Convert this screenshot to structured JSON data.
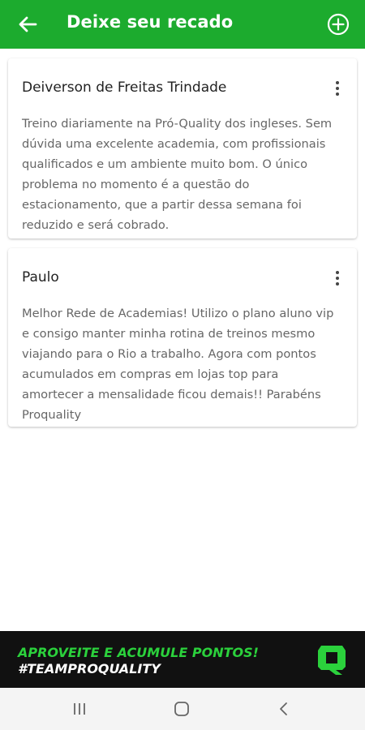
{
  "header": {
    "title": "Deixe seu recado",
    "back_icon": "arrow-left-icon",
    "add_icon": "plus-circle-icon",
    "color": "#1cab2e"
  },
  "messages": [
    {
      "name": "Deiverson de Freitas Trindade",
      "lines": [
        "Treino diariamente na Pró-Quality dos ingleses. Sem",
        "dúvida uma excelente academia, com profissionais",
        "qualificados e um ambiente muito bom. O único",
        "problema no momento é a questão do",
        "estacionamento, que a partir dessa semana foi",
        "reduzido e será cobrado."
      ]
    },
    {
      "name": "Paulo",
      "lines": [
        "Melhor Rede de Academias! Utilizo o plano aluno vip",
        "e consigo manter minha rotina de treinos mesmo",
        "viajando para o Rio a trabalho. Agora com pontos",
        "acumulados em compras em lojas top para",
        "amortecer a mensalidade ficou demais!! Parabéns",
        "Proquality"
      ]
    }
  ],
  "banner": {
    "line1": "APROVEITE E ACUMULE PONTOS!",
    "line2": "#TEAMPROQUALITY",
    "accent": "#2bd13c"
  },
  "navbar": {
    "icons": [
      "recent-apps-icon",
      "home-icon",
      "back-icon"
    ]
  }
}
